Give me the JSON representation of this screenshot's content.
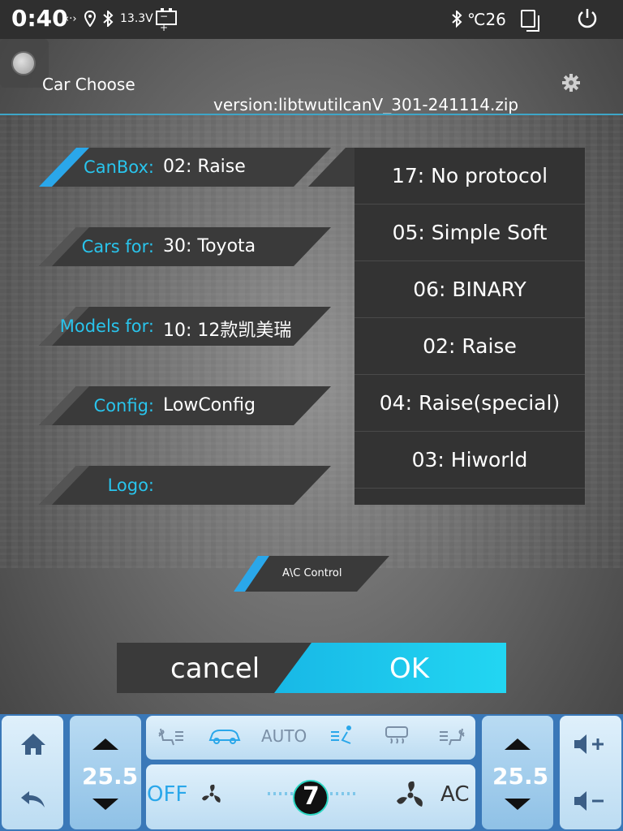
{
  "status": {
    "time": "0:40",
    "voltage": "13.3V",
    "temperature": "℃26"
  },
  "header": {
    "title": "Car Choose",
    "version": "version:libtwutilcanV_301-241114.zip"
  },
  "rows": [
    {
      "label": "CanBox:",
      "value": "02: Raise"
    },
    {
      "label": "Cars for:",
      "value": "30: Toyota"
    },
    {
      "label": "Models for:",
      "value": "10: 12款凯美瑞"
    },
    {
      "label": "Config:",
      "value": "LowConfig"
    },
    {
      "label": "Logo:",
      "value": ""
    }
  ],
  "list": {
    "items": [
      "17: No protocol",
      "05: Simple Soft",
      "06: BINARY",
      "02: Raise",
      "04: Raise(special)",
      "03: Hiworld"
    ]
  },
  "ac_control": "A\\C Control",
  "buttons": {
    "cancel": "cancel",
    "ok": "OK"
  },
  "climate": {
    "left_temp": "25.5",
    "right_temp": "25.5",
    "auto": "AUTO",
    "off": "OFF",
    "fan_level": "7",
    "ac": "AC"
  },
  "colors": {
    "accent": "#29c4ec",
    "ok": "#18b8e6",
    "bottom_bar": "#3a78b8"
  }
}
